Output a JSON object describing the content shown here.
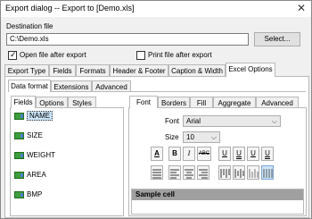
{
  "window": {
    "title": "Export dialog -- Export to [Demo.xls]",
    "close_glyph": "✕"
  },
  "destination": {
    "label": "Destination file",
    "value": "C:\\Demo.xls",
    "select_button": "Select..."
  },
  "options": {
    "open_after": {
      "label": "Open file after export",
      "checked": true
    },
    "print_after": {
      "label": "Print file after export",
      "checked": false
    }
  },
  "main_tabs": [
    "Export Type",
    "Fields",
    "Formats",
    "Header & Footer",
    "Caption & Width",
    "Excel Options"
  ],
  "sub_tabs": [
    "Data format",
    "Extensions",
    "Advanced"
  ],
  "left_tabs": [
    "Fields",
    "Options",
    "Styles"
  ],
  "fields_list": [
    "NAME",
    "SIZE",
    "WEIGHT",
    "AREA",
    "BMP"
  ],
  "right_tabs": [
    "Font",
    "Borders",
    "Fill",
    "Aggregate",
    "Advanced"
  ],
  "font": {
    "label": "Font",
    "value": "Arial",
    "size_label": "Size",
    "size_value": "10"
  },
  "toolbar_row1": [
    "A",
    "B",
    "I",
    "ABC",
    "U",
    "U",
    "U",
    "U"
  ],
  "sample_label": "Sample cell",
  "icons": {
    "close": "close-icon",
    "field": "field-icon",
    "dropdown": "chevron-down-icon",
    "align_left": "align-left-icon",
    "align_center": "align-center-icon",
    "align_right": "align-right-icon",
    "align_justify": "align-justify-icon"
  }
}
